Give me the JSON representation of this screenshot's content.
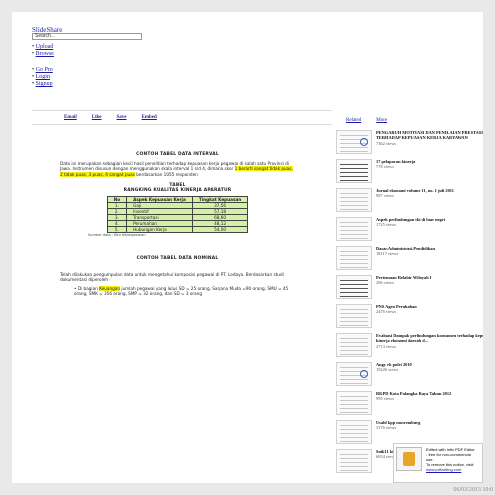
{
  "header": {
    "site_name": "SlideShare",
    "search_placeholder": "Search..."
  },
  "nav": {
    "primary": [
      "Upload",
      "Browse"
    ],
    "secondary": [
      "Go Pro",
      "Login",
      "Signup"
    ]
  },
  "actions": [
    "Email",
    "Like",
    "Save",
    "Embed"
  ],
  "sidebar_tabs": [
    "Related",
    "More"
  ],
  "document": {
    "title1": "CONTOH TABEL DATA INTERVAL",
    "para1_before": "Data ini merupakan sebagian kecil hasil penelitian terhadap kepuasan kerja pegawai di salah satu Provinsi di Jawa. Instrumen disusun dengan menggunakan skala interval 1 s/d 4, dimana skor ",
    "para1_highlight": "1 berarti sangat tidak puas, 2 tidak puas, 3 puas, 4 sangat puas",
    "para1_after": " berdasarkan 1055 responden",
    "table_caption": "TABEL",
    "table_title": "RANGKING KUALITAS KINERJA APARATUR",
    "table_headers": [
      "No",
      "Aspek Kepuasan Kerja",
      "Tingkat Kepuasan"
    ],
    "table_rows": [
      [
        "1.",
        "Gaji",
        "37,56"
      ],
      [
        "2.",
        "Insentif",
        "57,18"
      ],
      [
        "3.",
        "Transportasi",
        "68,60"
      ],
      [
        "4.",
        "Perumahan",
        "48,12"
      ],
      [
        "5.",
        "Hubungan Kerja",
        "54,00"
      ]
    ],
    "table_source": "Sumber data : Biro Kepegawaian",
    "title2": "CONTOH TABEL DATA NOMINAL",
    "para2": "Telah dilakukan pengumpulan data untuk mengetahui komposisi pegawai di PT. Lodaya. Berdasarkan studi dokumentasi diperoleh :",
    "bullet_before": "Di bagian ",
    "bullet_highlight": "Keuangan",
    "bullet_after": " jumlah pegawai yang lulus SD = 25 orang, Sarjana Muda =90 orang, SMU = 45 orang, SMK = 356 orang, SMP = 32 orang, dan SD = 3 orang"
  },
  "related": [
    {
      "title": "PENGARUH MOTIVASI DAN PENILAIAN PRESTASI TERHADAP KEPUASAN KERJA KARYAWAN",
      "views": "7362 views"
    },
    {
      "title": "17 pelaporan kinerja",
      "views": "778 views"
    },
    {
      "title": "Jurnal ekonomi volume 11, no. 1 juli 2011",
      "views": "987 views"
    },
    {
      "title": "Aspek perlindungan tki di luar negri",
      "views": "1725 views"
    },
    {
      "title": "Dasar.Administrasi.Pendidikan",
      "views": "18117 views"
    },
    {
      "title": "Pertemuan Relabir Wilayah I",
      "views": "206 views"
    },
    {
      "title": "PNS Agen Perubahan",
      "views": "2476 views"
    },
    {
      "title": "Evaluasi Dampak perlindungan konsumen terhadap kepuasan kinerja ekonomi daerah d...",
      "views": "2713 views"
    },
    {
      "title": "Angy rb pofri 2010",
      "views": "19226 views"
    },
    {
      "title": "RKPD Kota Palangka Raya Tahun 2012",
      "views": "995 views"
    },
    {
      "title": "Usahl kpp mosremburg",
      "views": "3176 views"
    },
    {
      "title": "Snik11 kimiaindustri-nuparni",
      "views": "6834 views"
    }
  ],
  "footer": {
    "line1": "Edited with Infix PDF Editor",
    "line2": "- free for non-commercial use.",
    "line3": "To remove this notice, visit:",
    "line4": "www.pdfwriting.com",
    "timestamp": "06/03/2013 10:0"
  }
}
